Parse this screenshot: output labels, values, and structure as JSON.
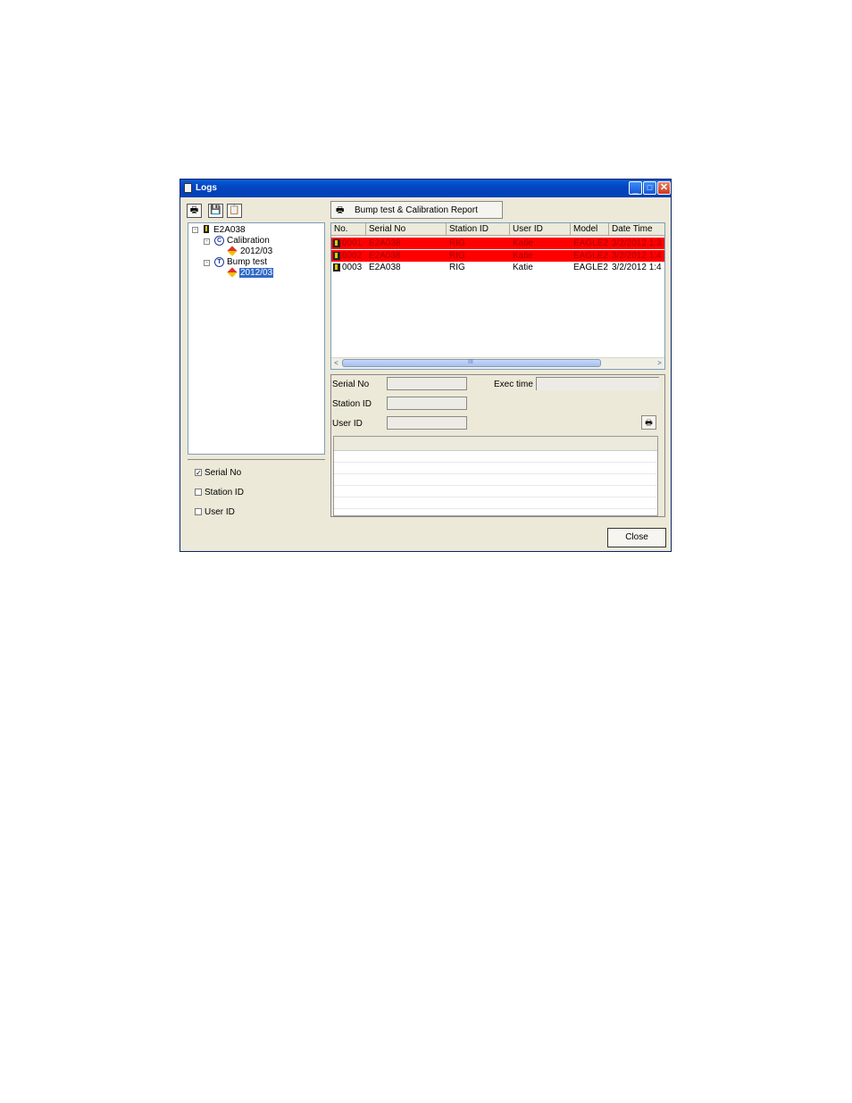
{
  "window": {
    "title": "Logs"
  },
  "toolbar": {
    "print_icon": "🖶",
    "save_icon": "💾",
    "clipboard_icon": "📋",
    "report_icon": "🖶",
    "report_label": "Bump test & Calibration Report"
  },
  "tree": {
    "root": "E2A038",
    "calibration": {
      "badge": "C",
      "label": "Calibration",
      "child": "2012/03"
    },
    "bump_test": {
      "badge": "T",
      "label": "Bump test",
      "child": "2012/03"
    }
  },
  "options": {
    "serial_no": {
      "label": "Serial No",
      "checked": "✓"
    },
    "station_id": {
      "label": "Station ID"
    },
    "user_id": {
      "label": "User ID"
    }
  },
  "table": {
    "headers": [
      "No.",
      "Serial No",
      "Station ID",
      "User ID",
      "Model",
      "Date Time"
    ],
    "rows": [
      {
        "no": "0001",
        "serial": "E2A038",
        "station": "RIG",
        "user": "Katie",
        "model": "EAGLE2",
        "datetime": "3/2/2012 1:3"
      },
      {
        "no": "0002",
        "serial": "E2A038",
        "station": "RIG",
        "user": "Katie",
        "model": "EAGLE2",
        "datetime": "3/2/2012 1:4"
      },
      {
        "no": "0003",
        "serial": "E2A038",
        "station": "RIG",
        "user": "Katie",
        "model": "EAGLE2",
        "datetime": "3/2/2012 1:4"
      }
    ],
    "highlight_color": "#ff0000"
  },
  "scrollbar": {
    "left_arrow": "<",
    "right_arrow": ">",
    "grip": "III"
  },
  "detail": {
    "serial_no_label": "Serial No",
    "exec_time_label": "Exec time",
    "station_id_label": "Station ID",
    "user_id_label": "User ID",
    "print_icon": "🖶"
  },
  "footer": {
    "close_label": "Close"
  },
  "title_buttons": {
    "minimize": "_",
    "maximize": "□",
    "close": "✕"
  }
}
